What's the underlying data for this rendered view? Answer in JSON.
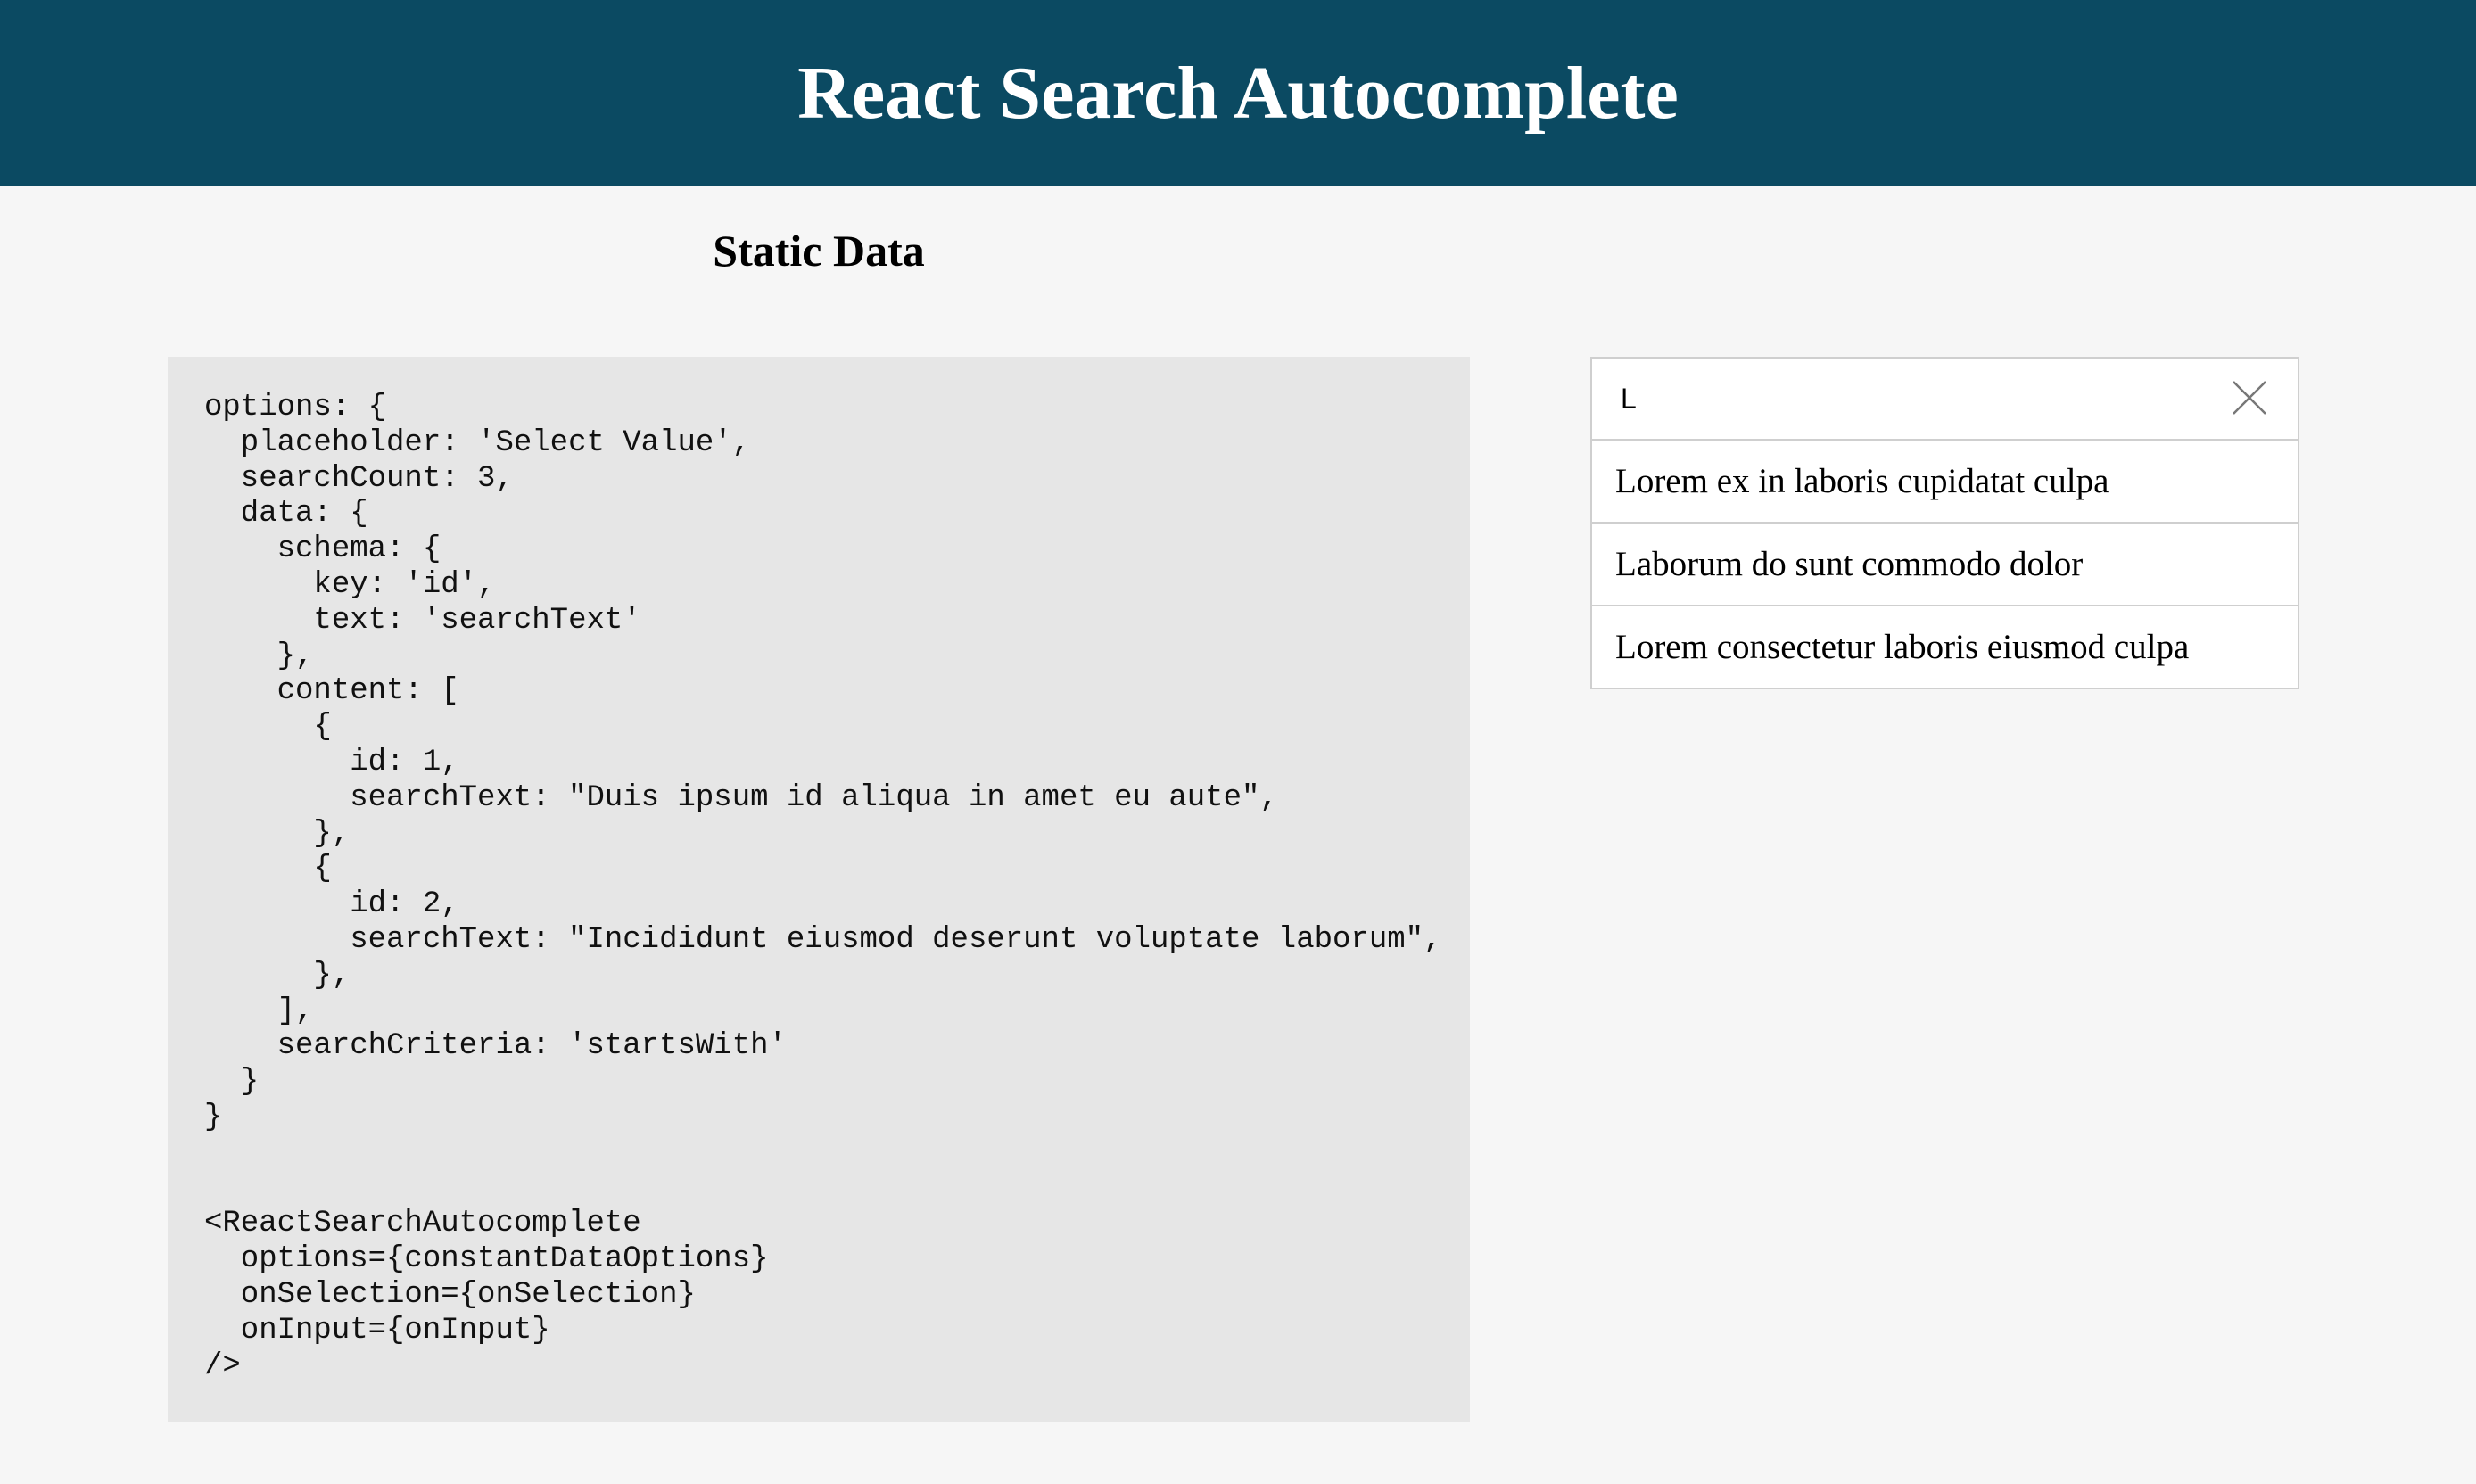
{
  "header": {
    "title": "React Search Autocomplete"
  },
  "section": {
    "title": "Static Data"
  },
  "code": "options: {\n  placeholder: 'Select Value',\n  searchCount: 3,\n  data: {\n    schema: {\n      key: 'id',\n      text: 'searchText'\n    },\n    content: [\n      {\n        id: 1,\n        searchText: \"Duis ipsum id aliqua in amet eu aute\",\n      },\n      {\n        id: 2,\n        searchText: \"Incididunt eiusmod deserunt voluptate laborum\",\n      },\n    ],\n    searchCriteria: 'startsWith'\n  }\n}\n\n\n<ReactSearchAutocomplete\n  options={constantDataOptions}\n  onSelection={onSelection}\n  onInput={onInput}\n/>",
  "search": {
    "value": "L",
    "clear_icon": "close-icon",
    "results": [
      {
        "label": "Lorem ex in laboris cupidatat culpa"
      },
      {
        "label": "Laborum do sunt commodo dolor"
      },
      {
        "label": "Lorem consectetur laboris eiusmod culpa"
      }
    ]
  },
  "colors": {
    "header_bg": "#0b4a62",
    "code_bg": "#e6e6e6",
    "page_bg": "#f6f6f6"
  }
}
